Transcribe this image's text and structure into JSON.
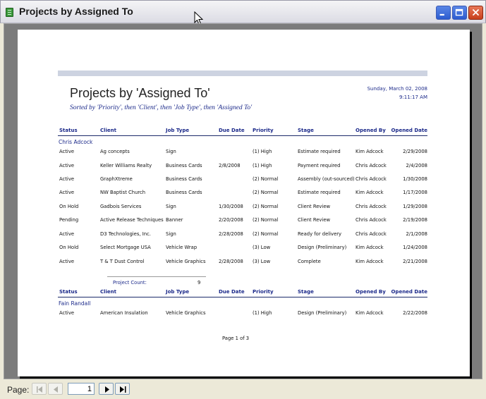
{
  "window": {
    "title": "Projects by Assigned To"
  },
  "report": {
    "title": "Projects by 'Assigned To'",
    "subtitle": "Sorted by 'Priority', then 'Client', then 'Job Type', then 'Assigned To'",
    "date": "Sunday, March 02, 2008",
    "time": "9:11:17 AM",
    "columns": [
      "Status",
      "Client",
      "Job Type",
      "Due Date",
      "Priority",
      "Stage",
      "Opened By",
      "Opened Date"
    ],
    "groups": [
      {
        "name": "Chris Adcock",
        "rows": [
          [
            "Active",
            "Ag concepts",
            "Sign",
            "",
            "(1) High",
            "Estimate required",
            "Kim Adcock",
            "2/29/2008"
          ],
          [
            "Active",
            "Keller Williams Realty",
            "Business Cards",
            "2/8/2008",
            "(1) High",
            "Payment required",
            "Chris Adcock",
            "2/4/2008"
          ],
          [
            "Active",
            "GraphXtreme",
            "Business Cards",
            "",
            "(2) Normal",
            "Assembly (out-sourced)",
            "Chris Adcock",
            "1/30/2008"
          ],
          [
            "Active",
            "NW Baptist Church",
            "Business Cards",
            "",
            "(2) Normal",
            "Estimate required",
            "Kim Adcock",
            "1/17/2008"
          ],
          [
            "On Hold",
            "Gadbois Services",
            "Sign",
            "1/30/2008",
            "(2) Normal",
            "Client Review",
            "Chris Adcock",
            "1/29/2008"
          ],
          [
            "Pending",
            "Active Release Techniques",
            "Banner",
            "2/20/2008",
            "(2) Normal",
            "Client Review",
            "Chris Adcock",
            "2/19/2008"
          ],
          [
            "Active",
            "D3 Technologies, Inc.",
            "Sign",
            "2/28/2008",
            "(2) Normal",
            "Ready for delivery",
            "Chris Adcock",
            "2/1/2008"
          ],
          [
            "On Hold",
            "Select Mortgage USA",
            "Vehicle Wrap",
            "",
            "(3) Low",
            "Design (Preliminary)",
            "Kim Adcock",
            "1/24/2008"
          ],
          [
            "Active",
            "T & T Dust Control",
            "Vehicle Graphics",
            "2/28/2008",
            "(3) Low",
            "Complete",
            "Kim Adcock",
            "2/21/2008"
          ]
        ],
        "count_label": "Project Count:",
        "count": "9"
      },
      {
        "name": "Fain Randall",
        "rows": [
          [
            "Active",
            "American Insulation",
            "Vehicle Graphics",
            "",
            "(1) High",
            "Design (Preliminary)",
            "Kim Adcock",
            "2/22/2008"
          ]
        ]
      }
    ],
    "footer": "Page 1 of 3"
  },
  "navigation": {
    "page_label": "Page:",
    "current_page": "1"
  },
  "icons": {
    "app": "access-report-icon",
    "minimize": "minimize-icon",
    "maximize": "maximize-icon",
    "close": "close-icon",
    "first": "first-page-icon",
    "prev": "previous-page-icon",
    "next": "next-page-icon",
    "last": "last-page-icon"
  },
  "colors": {
    "report_accent": "#1c2a8a",
    "header_bar": "#cdd3e1",
    "close_button": "#c8401c"
  }
}
